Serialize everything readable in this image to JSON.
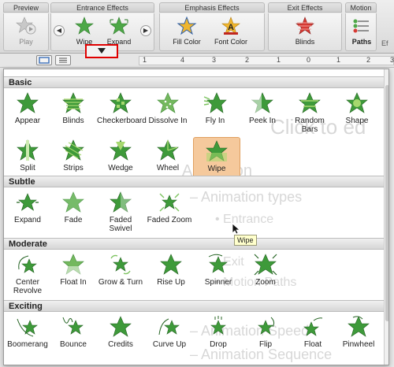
{
  "ribbon": {
    "preview": {
      "title": "Preview",
      "play_label": "Play"
    },
    "entrance": {
      "title": "Entrance Effects",
      "items": [
        "Wipe",
        "Expand"
      ]
    },
    "emphasis": {
      "title": "Emphasis Effects",
      "items": [
        "Fill Color",
        "Font Color"
      ]
    },
    "exit": {
      "title": "Exit Effects",
      "items": [
        "Blinds"
      ]
    },
    "motion": {
      "title": "Motion",
      "paths_label": "Paths"
    },
    "cut_label": "Ef"
  },
  "ruler": {
    "marks": [
      "1",
      "4",
      "3",
      "2",
      "1",
      "0",
      "1",
      "2",
      "3"
    ]
  },
  "gallery": {
    "categories": [
      {
        "name": "Basic",
        "effects": [
          "Appear",
          "Blinds",
          "Checkerboard",
          "Dissolve In",
          "Fly In",
          "Peek In",
          "Random Bars",
          "Shape",
          "Split",
          "Strips",
          "Wedge",
          "Wheel",
          "Wipe"
        ]
      },
      {
        "name": "Subtle",
        "effects": [
          "Expand",
          "Fade",
          "Faded Swivel",
          "Faded Zoom"
        ]
      },
      {
        "name": "Moderate",
        "effects": [
          "Center Revolve",
          "Float In",
          "Grow & Turn",
          "Rise Up",
          "Spinner",
          "Zoom"
        ]
      },
      {
        "name": "Exciting",
        "effects": [
          "Boomerang",
          "Bounce",
          "Credits",
          "Curve Up",
          "Drop",
          "Flip",
          "Float",
          "Pinwheel"
        ]
      }
    ],
    "selected": "Wipe",
    "tooltip": "Wipe"
  },
  "background_slide": {
    "title": "Click to ed",
    "lines": [
      "Animation",
      "– Animation types",
      "• Entrance",
      "• Exit",
      "• Motion Paths",
      "– Animation Speed",
      "– Animation Sequence"
    ]
  },
  "colors": {
    "star_green": "#3e9a3a",
    "star_light": "#a6d86e",
    "selected_bg": "#f5c99c",
    "marker_red": "#e00000"
  }
}
